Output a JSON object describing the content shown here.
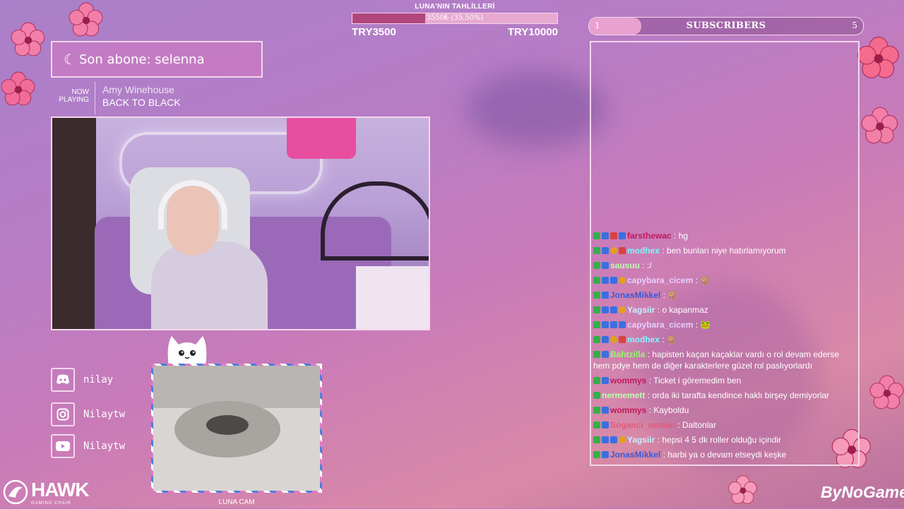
{
  "goal": {
    "title": "LUNA'NIN TAHLİLLERİ",
    "progress_text": "3550₺ (35.50%)",
    "progress_fraction": 0.355,
    "start": "TRY3500",
    "end": "TRY10000"
  },
  "subscribers": {
    "label": "SUBSCRIBERS",
    "current": "1",
    "target": "5"
  },
  "latest_sub": {
    "text": "Son abone: selenna",
    "icon": "crescent-moon-icon"
  },
  "now_playing": {
    "label_line1": "NOW",
    "label_line2": "PLAYING",
    "artist": "Amy Winehouse",
    "track": "BACK TO BLACK"
  },
  "social": [
    {
      "icon": "discord-icon",
      "handle": "nilay"
    },
    {
      "icon": "instagram-icon",
      "handle": "Nilaytw"
    },
    {
      "icon": "youtube-icon",
      "handle": "Nilaytw"
    }
  ],
  "catcam": {
    "label": "LUNA CAM"
  },
  "chat": [
    {
      "user": "farsthewac",
      "color": "#c2185b",
      "badges": [
        "k",
        "d",
        "s",
        "d"
      ],
      "text": ": hg"
    },
    {
      "user": "modhex",
      "color": "#7df9ff",
      "badges": [
        "k",
        "d",
        "c",
        "s"
      ],
      "text": ": ben bunları niye hatırlamıyorum"
    },
    {
      "user": "sausuu",
      "color": "#b8ffb0",
      "badges": [
        "k",
        "d"
      ],
      "text": ": :/"
    },
    {
      "user": "capybara_cicem",
      "color": "#e6d0ff",
      "badges": [
        "k",
        "d",
        "d",
        "c"
      ],
      "text": ": 🐒"
    },
    {
      "user": "JonasMikkel",
      "color": "#3a58d6",
      "badges": [
        "k",
        "d"
      ],
      "text": ": 🐒"
    },
    {
      "user": "Yagsiir",
      "color": "#c6f1ff",
      "badges": [
        "k",
        "d",
        "d",
        "c"
      ],
      "text": ": o kapanmaz"
    },
    {
      "user": "capybara_cicem",
      "color": "#e6d0ff",
      "badges": [
        "k",
        "d",
        "d",
        "d"
      ],
      "text": ": 🐸"
    },
    {
      "user": "modhex",
      "color": "#7df9ff",
      "badges": [
        "k",
        "d",
        "c",
        "s"
      ],
      "text": ": 🐒"
    },
    {
      "user": "Bahtzilla",
      "color": "#8cff6b",
      "badges": [
        "k",
        "d"
      ],
      "text": ": hapisten kaçan kaçaklar vardı o rol devam ederse hem pdye hem de diğer karakterlere güzel rol paslıyorlardı"
    },
    {
      "user": "wommys",
      "color": "#c2185b",
      "badges": [
        "k",
        "d"
      ],
      "text": ": Ticket i göremedim ben"
    },
    {
      "user": "nermemett",
      "color": "#b8ffb0",
      "badges": [
        "k"
      ],
      "text": ": orda iki tarafta kendince haklı birşey demiyorlar"
    },
    {
      "user": "wommys",
      "color": "#c2185b",
      "badges": [
        "k",
        "d"
      ],
      "text": ": Kayboldu"
    },
    {
      "user": "Soganci_osman",
      "color": "#e35a7a",
      "badges": [
        "k",
        "d"
      ],
      "text": ": Daltonlar"
    },
    {
      "user": "Yagsiir",
      "color": "#c6f1ff",
      "badges": [
        "k",
        "d",
        "d",
        "c"
      ],
      "text": ": hepsi 4 5 dk roller olduğu içindir"
    },
    {
      "user": "JonasMikkel",
      "color": "#3a58d6",
      "badges": [
        "k",
        "d"
      ],
      "text": ": harbi ya o devam etseydi keşke"
    }
  ],
  "sponsors": {
    "hawk": "HAWK",
    "hawk_sub": "GAMING CHAIR",
    "bynogame": "ByNoGame"
  },
  "colors": {
    "frame": "#f4d7ec",
    "goal_fill": "#b0467d",
    "sub_fill": "#e9a2cf"
  }
}
